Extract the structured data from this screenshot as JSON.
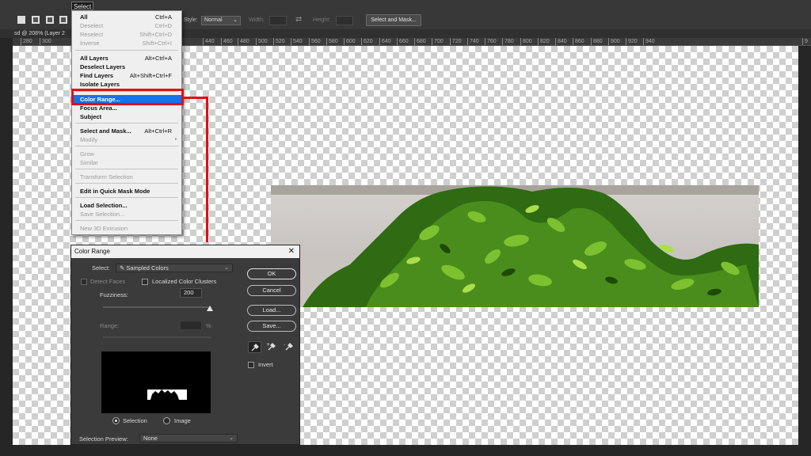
{
  "optbar": {
    "menu_title": "Select",
    "style_label": "Style:",
    "style_value": "Normal",
    "width_label": "Width:",
    "height_label": "Height:",
    "select_mask_label": "Select and Mask..."
  },
  "doc_tab": "sd @ 208% (Layer 2",
  "ruler_ticks": [
    "280",
    "300",
    "440",
    "460",
    "480",
    "500",
    "520",
    "540",
    "560",
    "580",
    "600",
    "620",
    "640",
    "660",
    "680",
    "700",
    "720",
    "740",
    "760",
    "780",
    "800",
    "820",
    "840",
    "860",
    "880",
    "900",
    "920",
    "940",
    "9"
  ],
  "select_menu": {
    "items": [
      {
        "label": "All",
        "shortcut": "Ctrl+A",
        "enabled": true
      },
      {
        "label": "Deselect",
        "shortcut": "Ctrl+D",
        "enabled": false
      },
      {
        "label": "Reselect",
        "shortcut": "Shift+Ctrl+D",
        "enabled": false
      },
      {
        "label": "Inverse",
        "shortcut": "Shift+Ctrl+I",
        "enabled": false
      },
      {
        "label": "All Layers",
        "shortcut": "Alt+Ctrl+A",
        "enabled": true
      },
      {
        "label": "Deselect Layers",
        "shortcut": "",
        "enabled": true
      },
      {
        "label": "Find Layers",
        "shortcut": "Alt+Shift+Ctrl+F",
        "enabled": true
      },
      {
        "label": "Isolate Layers",
        "shortcut": "",
        "enabled": true
      },
      {
        "label": "Color Range...",
        "shortcut": "",
        "enabled": true,
        "highlighted": true
      },
      {
        "label": "Focus Area...",
        "shortcut": "",
        "enabled": true
      },
      {
        "label": "Subject",
        "shortcut": "",
        "enabled": true
      },
      {
        "label": "Select and Mask...",
        "shortcut": "Alt+Ctrl+R",
        "enabled": true
      },
      {
        "label": "Modify",
        "shortcut": "",
        "enabled": false,
        "submenu": true
      },
      {
        "label": "Grow",
        "shortcut": "",
        "enabled": false
      },
      {
        "label": "Similar",
        "shortcut": "",
        "enabled": false
      },
      {
        "label": "Transform Selection",
        "shortcut": "",
        "enabled": false
      },
      {
        "label": "Edit in Quick Mask Mode",
        "shortcut": "",
        "enabled": true
      },
      {
        "label": "Load Selection...",
        "shortcut": "",
        "enabled": true
      },
      {
        "label": "Save Selection...",
        "shortcut": "",
        "enabled": false
      },
      {
        "label": "New 3D Extrusion",
        "shortcut": "",
        "enabled": false
      }
    ]
  },
  "dialog": {
    "title": "Color Range",
    "select_label": "Select:",
    "select_value": "Sampled Colors",
    "detect_faces_label": "Detect Faces",
    "localized_label": "Localized Color Clusters",
    "fuzziness_label": "Fuzziness:",
    "fuzziness_value": "200",
    "range_label": "Range:",
    "range_unit": "%",
    "radio_selection": "Selection",
    "radio_image": "Image",
    "preview_label": "Selection Preview:",
    "preview_value": "None",
    "ok_label": "OK",
    "cancel_label": "Cancel",
    "load_label": "Load...",
    "save_label": "Save...",
    "invert_label": "Invert"
  },
  "colors": {
    "highlight": "#1473e6",
    "annotation": "#e01010"
  }
}
